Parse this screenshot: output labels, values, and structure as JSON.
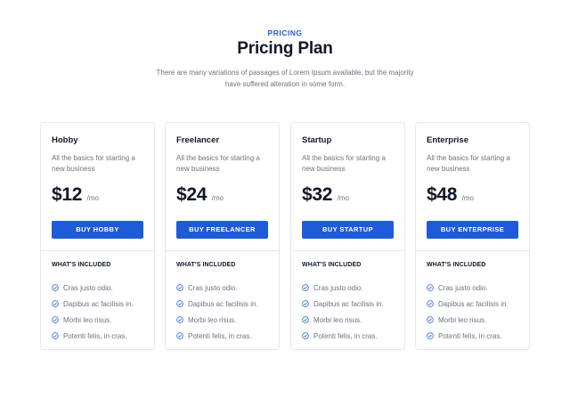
{
  "header": {
    "eyebrow": "PRICING",
    "title": "Pricing Plan",
    "subtitle": "There are many variations of passages of Lorem Ipsum available, but the majority have suffered alteration in some form."
  },
  "plans": [
    {
      "name": "Hobby",
      "description": "All the basics for starting a new business",
      "price": "$12",
      "period": "/mo",
      "button": "BUY HOBBY",
      "included_heading": "WHAT'S INCLUDED",
      "features": [
        "Cras justo odio.",
        "Dapibus ac facilisis in.",
        "Morbi leo risus.",
        "Potenti felis, in cras."
      ]
    },
    {
      "name": "Freelancer",
      "description": "All the basics for starting a new business",
      "price": "$24",
      "period": "/mo",
      "button": "BUY FREELANCER",
      "included_heading": "WHAT'S INCLUDED",
      "features": [
        "Cras justo odio.",
        "Dapibus ac facilisis in.",
        "Morbi leo risus.",
        "Potenti felis, in cras."
      ]
    },
    {
      "name": "Startup",
      "description": "All the basics for starting a new business",
      "price": "$32",
      "period": "/mo",
      "button": "BUY STARTUP",
      "included_heading": "WHAT'S INCLUDED",
      "features": [
        "Cras justo odio.",
        "Dapibus ac facilisis in.",
        "Morbi leo risus.",
        "Potenti felis, in cras."
      ]
    },
    {
      "name": "Enterprise",
      "description": "All the basics for starting a new business",
      "price": "$48",
      "period": "/mo",
      "button": "BUY ENTERPRISE",
      "included_heading": "WHAT'S INCLUDED",
      "features": [
        "Cras justo odio.",
        "Dapibus ac facilisis in.",
        "Morbi leo risus.",
        "Potenti felis, in cras."
      ]
    }
  ],
  "icons": {
    "feature": "check-circle-icon"
  },
  "colors": {
    "accent": "#1d5bd8",
    "text": "#111827",
    "muted": "#6b7280",
    "border": "#e5e7eb"
  }
}
